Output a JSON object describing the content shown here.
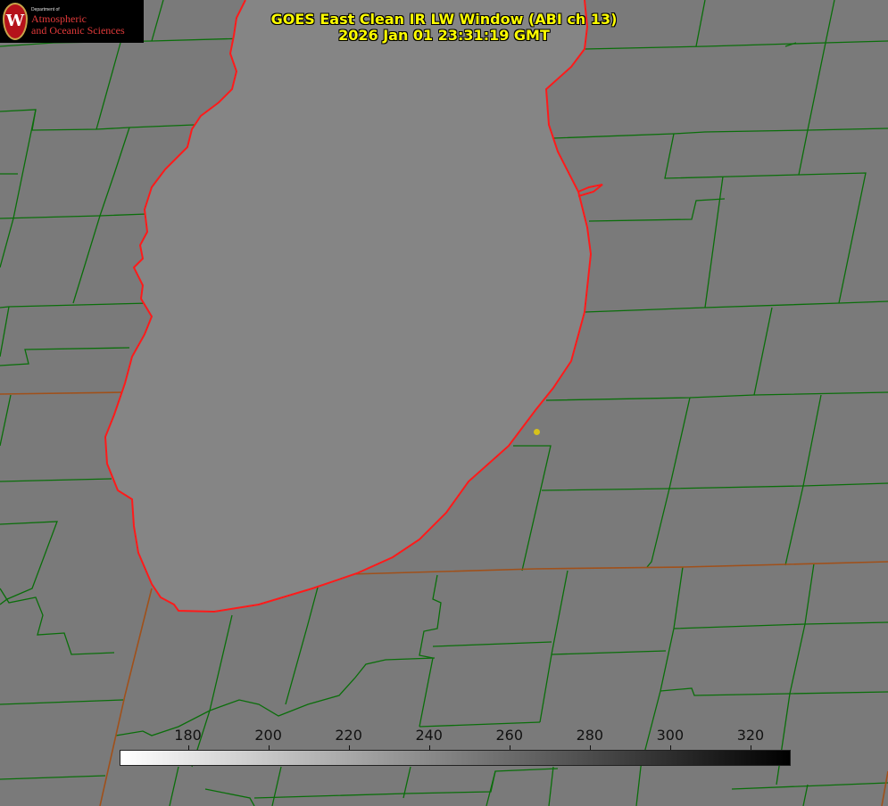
{
  "title": {
    "line1": "GOES East Clean IR LW Window (ABI ch 13)",
    "line2": "2026 Jan 01 23:31:19 GMT"
  },
  "logo": {
    "seal_letter": "W",
    "department": "Department of",
    "name_line1": "Atmospheric",
    "name_line2": "and Oceanic Sciences"
  },
  "colorbar": {
    "ticks": [
      "180",
      "200",
      "220",
      "240",
      "260",
      "280",
      "300",
      "320"
    ],
    "min_value": 163,
    "max_value": 330,
    "start_color": "#ffffff",
    "end_color": "#000000"
  },
  "colors": {
    "background": "#7a7a7a",
    "lake": "#858585",
    "county_lines": "#0a6e0a",
    "shoreline": "#ff1a1a",
    "state_line": "#a0501a",
    "title_text": "#ffff00"
  }
}
